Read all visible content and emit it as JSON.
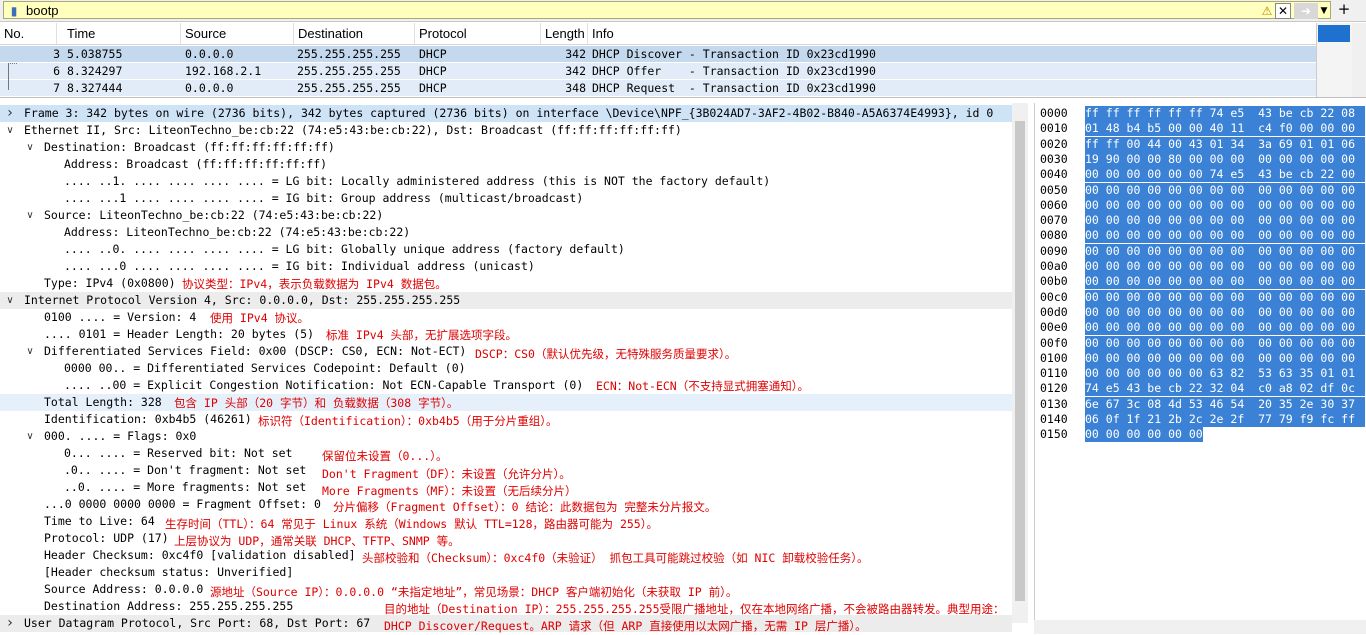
{
  "filter": {
    "value": "bootp"
  },
  "packet_list": {
    "columns": [
      "No.",
      "Time",
      "Source",
      "Destination",
      "Protocol",
      "Length",
      "Info"
    ],
    "rows": [
      {
        "no": "3",
        "time": "5.038755",
        "src": "0.0.0.0",
        "dst": "255.255.255.255",
        "proto": "DHCP",
        "len": "342",
        "info": "DHCP Discover - Transaction ID 0x23cd1990",
        "selected": true
      },
      {
        "no": "6",
        "time": "8.324297",
        "src": "192.168.2.1",
        "dst": "255.255.255.255",
        "proto": "DHCP",
        "len": "342",
        "info": "DHCP Offer    - Transaction ID 0x23cd1990",
        "selected": false
      },
      {
        "no": "7",
        "time": "8.327444",
        "src": "0.0.0.0",
        "dst": "255.255.255.255",
        "proto": "DHCP",
        "len": "348",
        "info": "DHCP Request  - Transaction ID 0x23cd1990",
        "selected": false
      }
    ]
  },
  "details": [
    {
      "level": 0,
      "arrow": "right",
      "text": "Frame 3: 342 bytes on wire (2736 bits), 342 bytes captured (2736 bits) on interface \\Device\\NPF_{3B024AD7-3AF2-4B02-B840-A5A6374E4993}, id 0",
      "hl": "sel"
    },
    {
      "level": 0,
      "arrow": "down",
      "text": "Ethernet II, Src: LiteonTechno_be:cb:22 (74:e5:43:be:cb:22), Dst: Broadcast (ff:ff:ff:ff:ff:ff)",
      "hl": ""
    },
    {
      "level": 1,
      "arrow": "down",
      "text": "Destination: Broadcast (ff:ff:ff:ff:ff:ff)",
      "hl": ""
    },
    {
      "level": 2,
      "arrow": "",
      "text": "Address: Broadcast (ff:ff:ff:ff:ff:ff)",
      "hl": ""
    },
    {
      "level": 2,
      "arrow": "",
      "text": ".... ..1. .... .... .... .... = LG bit: Locally administered address (this is NOT the factory default)",
      "hl": ""
    },
    {
      "level": 2,
      "arrow": "",
      "text": ".... ...1 .... .... .... .... = IG bit: Group address (multicast/broadcast)",
      "hl": ""
    },
    {
      "level": 1,
      "arrow": "down",
      "text": "Source: LiteonTechno_be:cb:22 (74:e5:43:be:cb:22)",
      "hl": ""
    },
    {
      "level": 2,
      "arrow": "",
      "text": "Address: LiteonTechno_be:cb:22 (74:e5:43:be:cb:22)",
      "hl": ""
    },
    {
      "level": 2,
      "arrow": "",
      "text": ".... ..0. .... .... .... .... = LG bit: Globally unique address (factory default)",
      "hl": ""
    },
    {
      "level": 2,
      "arrow": "",
      "text": ".... ...0 .... .... .... .... = IG bit: Individual address (unicast)",
      "hl": ""
    },
    {
      "level": 1,
      "arrow": "",
      "text": "Type: IPv4 (0x0800)",
      "hl": ""
    },
    {
      "level": 0,
      "arrow": "down",
      "text": "Internet Protocol Version 4, Src: 0.0.0.0, Dst: 255.255.255.255",
      "hl": "grey"
    },
    {
      "level": 1,
      "arrow": "",
      "text": "0100 .... = Version: 4",
      "hl": ""
    },
    {
      "level": 1,
      "arrow": "",
      "text": ".... 0101 = Header Length: 20 bytes (5)",
      "hl": ""
    },
    {
      "level": 1,
      "arrow": "down",
      "text": "Differentiated Services Field: 0x00 (DSCP: CS0, ECN: Not-ECT)",
      "hl": ""
    },
    {
      "level": 2,
      "arrow": "",
      "text": "0000 00.. = Differentiated Services Codepoint: Default (0)",
      "hl": ""
    },
    {
      "level": 2,
      "arrow": "",
      "text": ".... ..00 = Explicit Congestion Notification: Not ECN-Capable Transport (0)",
      "hl": ""
    },
    {
      "level": 1,
      "arrow": "",
      "text": "Total Length: 328",
      "hl": "blue"
    },
    {
      "level": 1,
      "arrow": "",
      "text": "Identification: 0xb4b5 (46261)",
      "hl": ""
    },
    {
      "level": 1,
      "arrow": "down",
      "text": "000. .... = Flags: 0x0",
      "hl": ""
    },
    {
      "level": 2,
      "arrow": "",
      "text": "0... .... = Reserved bit: Not set",
      "hl": ""
    },
    {
      "level": 2,
      "arrow": "",
      "text": ".0.. .... = Don't fragment: Not set",
      "hl": ""
    },
    {
      "level": 2,
      "arrow": "",
      "text": "..0. .... = More fragments: Not set",
      "hl": ""
    },
    {
      "level": 1,
      "arrow": "",
      "text": "...0 0000 0000 0000 = Fragment Offset: 0",
      "hl": ""
    },
    {
      "level": 1,
      "arrow": "",
      "text": "Time to Live: 64",
      "hl": ""
    },
    {
      "level": 1,
      "arrow": "",
      "text": "Protocol: UDP (17)",
      "hl": ""
    },
    {
      "level": 1,
      "arrow": "",
      "text": "Header Checksum: 0xc4f0 [validation disabled]",
      "hl": ""
    },
    {
      "level": 1,
      "arrow": "",
      "text": "[Header checksum status: Unverified]",
      "hl": ""
    },
    {
      "level": 1,
      "arrow": "",
      "text": "Source Address: 0.0.0.0",
      "hl": ""
    },
    {
      "level": 1,
      "arrow": "",
      "text": "Destination Address: 255.255.255.255",
      "hl": ""
    },
    {
      "level": 0,
      "arrow": "right",
      "text": "User Datagram Protocol, Src Port: 68, Dst Port: 67",
      "hl": "grey"
    }
  ],
  "annotations": [
    {
      "text": "协议类型：IPv4，表示负载数据为 IPv4 数据包。"
    },
    {
      "text": "使用 IPv4 协议。"
    },
    {
      "text": "标准 IPv4 头部，无扩展选项字段。"
    },
    {
      "text": "DSCP：CS0（默认优先级，无特殊服务质量要求）。"
    },
    {
      "text": "ECN：Not-ECN（不支持显式拥塞通知）。"
    },
    {
      "text": "包含 IP 头部（20 字节）和 负载数据（308 字节）。"
    },
    {
      "text": "标识符（Identification）：0xb4b5（用于分片重组）。"
    },
    {
      "text": "保留位未设置（0...）。"
    },
    {
      "text": "Don't Fragment（DF）：未设置（允许分片）。"
    },
    {
      "text": "More Fragments（MF）：未设置（无后续分片）"
    },
    {
      "text": "分片偏移（Fragment Offset）：0 结论：此数据包为 完整未分片报文。"
    },
    {
      "text": "生存时间（TTL）：64 常见于 Linux 系统（Windows 默认 TTL=128，路由器可能为 255）。"
    },
    {
      "text": "上层协议为 UDP，通常关联 DHCP、TFTP、SNMP 等。"
    },
    {
      "text": "头部校验和（Checksum）：0xc4f0（未验证） 抓包工具可能跳过校验（如 NIC 卸载校验任务）。"
    },
    {
      "text": "源地址（Source IP）：0.0.0.0 “未指定地址”，常见场景：DHCP 客户端初始化（未获取 IP 前）。"
    },
    {
      "text": "目的地址（Destination IP）：255.255.255.255受限广播地址，仅在本地网络广播，不会被路由器转发。典型用途："
    },
    {
      "text": "DHCP Discover/Request。ARP 请求（但 ARP 直接使用以太网广播，无需 IP 层广播）。"
    }
  ],
  "hex": [
    {
      "off": "0000",
      "bytes": "ff ff ff ff ff ff 74 e5  43 be cb 22 08"
    },
    {
      "off": "0010",
      "bytes": "01 48 b4 b5 00 00 40 11  c4 f0 00 00 00"
    },
    {
      "off": "0020",
      "bytes": "ff ff 00 44 00 43 01 34  3a 69 01 01 06"
    },
    {
      "off": "0030",
      "bytes": "19 90 00 00 80 00 00 00  00 00 00 00 00"
    },
    {
      "off": "0040",
      "bytes": "00 00 00 00 00 00 74 e5  43 be cb 22 00"
    },
    {
      "off": "0050",
      "bytes": "00 00 00 00 00 00 00 00  00 00 00 00 00"
    },
    {
      "off": "0060",
      "bytes": "00 00 00 00 00 00 00 00  00 00 00 00 00"
    },
    {
      "off": "0070",
      "bytes": "00 00 00 00 00 00 00 00  00 00 00 00 00"
    },
    {
      "off": "0080",
      "bytes": "00 00 00 00 00 00 00 00  00 00 00 00 00"
    },
    {
      "off": "0090",
      "bytes": "00 00 00 00 00 00 00 00  00 00 00 00 00"
    },
    {
      "off": "00a0",
      "bytes": "00 00 00 00 00 00 00 00  00 00 00 00 00"
    },
    {
      "off": "00b0",
      "bytes": "00 00 00 00 00 00 00 00  00 00 00 00 00"
    },
    {
      "off": "00c0",
      "bytes": "00 00 00 00 00 00 00 00  00 00 00 00 00"
    },
    {
      "off": "00d0",
      "bytes": "00 00 00 00 00 00 00 00  00 00 00 00 00"
    },
    {
      "off": "00e0",
      "bytes": "00 00 00 00 00 00 00 00  00 00 00 00 00"
    },
    {
      "off": "00f0",
      "bytes": "00 00 00 00 00 00 00 00  00 00 00 00 00"
    },
    {
      "off": "0100",
      "bytes": "00 00 00 00 00 00 00 00  00 00 00 00 00"
    },
    {
      "off": "0110",
      "bytes": "00 00 00 00 00 00 63 82  53 63 35 01 01"
    },
    {
      "off": "0120",
      "bytes": "74 e5 43 be cb 22 32 04  c0 a8 02 df 0c"
    },
    {
      "off": "0130",
      "bytes": "6e 67 3c 08 4d 53 46 54  20 35 2e 30 37"
    },
    {
      "off": "0140",
      "bytes": "06 0f 1f 21 2b 2c 2e 2f  77 79 f9 fc ff"
    },
    {
      "off": "0150",
      "bytes": "00 00 00 00 00 00"
    }
  ]
}
